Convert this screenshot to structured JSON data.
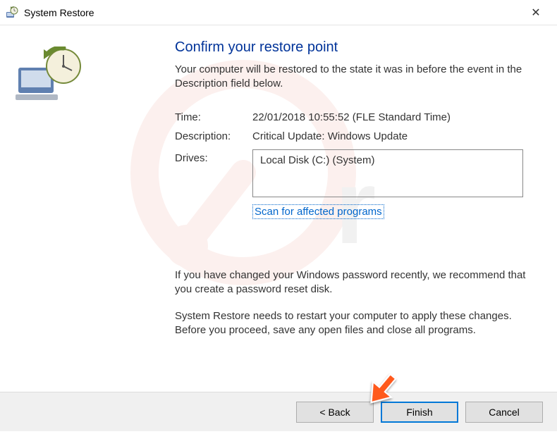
{
  "titlebar": {
    "title": "System Restore",
    "close_symbol": "✕"
  },
  "heading": "Confirm your restore point",
  "subtext": "Your computer will be restored to the state it was in before the event in the Description field below.",
  "fields": {
    "time_label": "Time:",
    "time_value": "22/01/2018 10:55:52 (FLE Standard Time)",
    "description_label": "Description:",
    "description_value": "Critical Update: Windows Update",
    "drives_label": "Drives:",
    "drives_value": "Local Disk (C:) (System)"
  },
  "scan_link": "Scan for affected programs",
  "password_note": "If you have changed your Windows password recently, we recommend that you create a password reset disk.",
  "restart_note": "System Restore needs to restart your computer to apply these changes. Before you proceed, save any open files and close all programs.",
  "buttons": {
    "back": "< Back",
    "finish": "Finish",
    "cancel": "Cancel"
  }
}
